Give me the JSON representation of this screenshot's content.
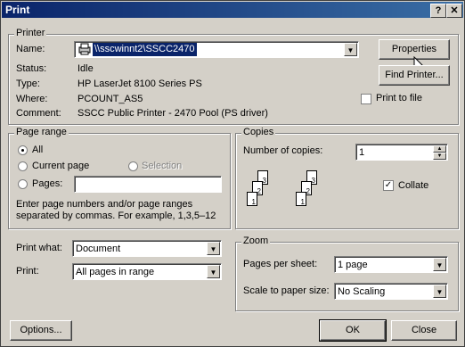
{
  "window": {
    "title": "Print",
    "help_label": "?",
    "close_label": "✕"
  },
  "printer": {
    "group_title": "Printer",
    "name_label": "Name:",
    "name_value": "\\\\sscwinnt2\\SSCC2470",
    "properties_label": "Properties",
    "find_printer_label": "Find Printer...",
    "print_to_file_label": "Print to file",
    "status_label": "Status:",
    "status_value": "Idle",
    "type_label": "Type:",
    "type_value": "HP LaserJet 8100 Series PS",
    "where_label": "Where:",
    "where_value": "PCOUNT_AS5",
    "comment_label": "Comment:",
    "comment_value": "SSCC Public Printer - 2470 Pool (PS driver)"
  },
  "page_range": {
    "group_title": "Page range",
    "all_label": "All",
    "current_page_label": "Current page",
    "selection_label": "Selection",
    "pages_label": "Pages:",
    "pages_value": "",
    "hint_line1": "Enter page numbers and/or page ranges",
    "hint_line2": "separated by commas.  For example, 1,3,5–12"
  },
  "copies": {
    "group_title": "Copies",
    "number_label": "Number of copies:",
    "number_value": "1",
    "collate_label": "Collate",
    "page_labels": [
      "1",
      "2",
      "3"
    ]
  },
  "print_what": {
    "label": "Print what:",
    "value": "Document"
  },
  "print": {
    "label": "Print:",
    "value": "All pages in range"
  },
  "zoom": {
    "group_title": "Zoom",
    "pages_per_sheet_label": "Pages per sheet:",
    "pages_per_sheet_value": "1 page",
    "scale_label": "Scale to paper size:",
    "scale_value": "No Scaling"
  },
  "footer": {
    "options_label": "Options...",
    "ok_label": "OK",
    "close_label": "Close"
  },
  "icons": {
    "printer_icon": "printer-icon",
    "dropdown_arrow": "chevron-down-icon"
  }
}
